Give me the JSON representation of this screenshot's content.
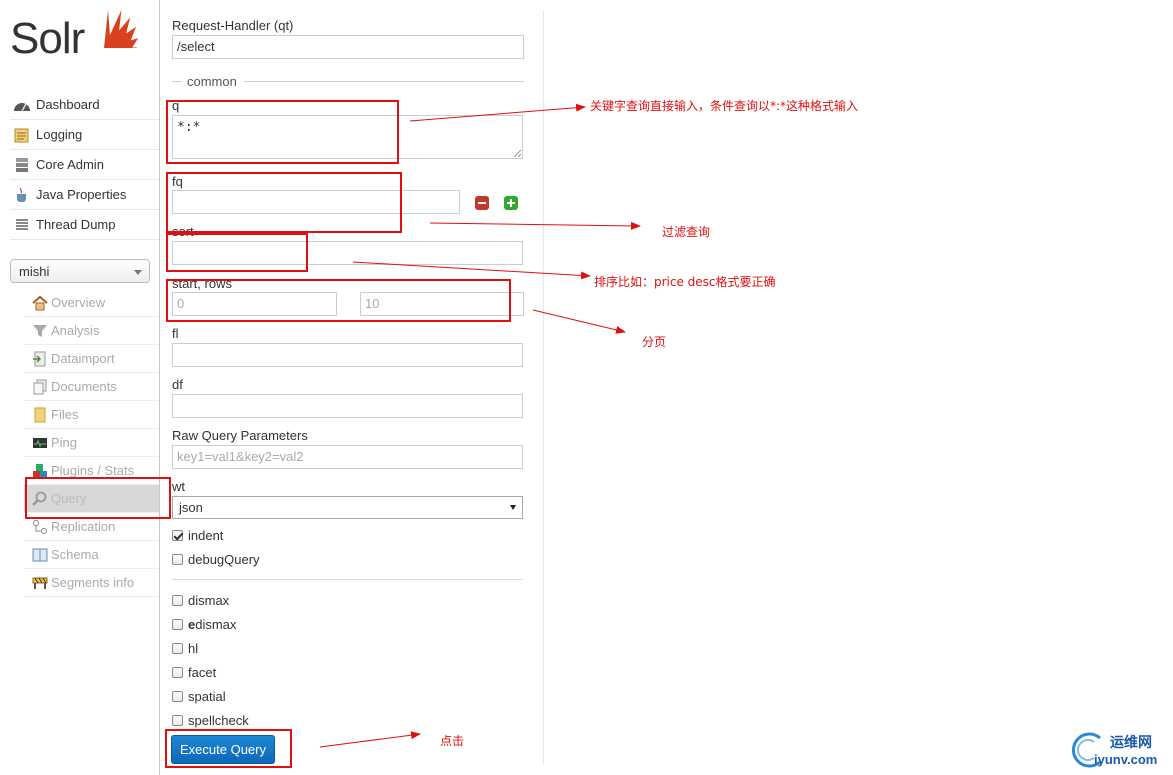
{
  "app": {
    "logo_text": "Solr"
  },
  "colors": {
    "brand_orange": "#d9411e",
    "annotation_red": "#e01010",
    "primary_blue": "#1475c8",
    "watermark_blue": "#1a5aa8"
  },
  "sidebar": {
    "main_items": [
      {
        "label": "Dashboard",
        "icon": "dashboard-icon"
      },
      {
        "label": "Logging",
        "icon": "logging-icon"
      },
      {
        "label": "Core Admin",
        "icon": "core-admin-icon"
      },
      {
        "label": "Java Properties",
        "icon": "java-properties-icon"
      },
      {
        "label": "Thread Dump",
        "icon": "thread-dump-icon"
      }
    ],
    "core_selector": {
      "selected": "mishi"
    },
    "core_items": [
      {
        "label": "Overview",
        "icon": "home-icon"
      },
      {
        "label": "Analysis",
        "icon": "filter-icon"
      },
      {
        "label": "Dataimport",
        "icon": "dataimport-icon"
      },
      {
        "label": "Documents",
        "icon": "documents-icon"
      },
      {
        "label": "Files",
        "icon": "files-icon"
      },
      {
        "label": "Ping",
        "icon": "ping-icon"
      },
      {
        "label": "Plugins / Stats",
        "icon": "plugins-icon"
      },
      {
        "label": "Query",
        "icon": "search-icon",
        "active": true
      },
      {
        "label": "Replication",
        "icon": "replication-icon"
      },
      {
        "label": "Schema",
        "icon": "schema-icon"
      },
      {
        "label": "Segments info",
        "icon": "segments-icon"
      }
    ]
  },
  "form": {
    "request_handler": {
      "label": "Request-Handler (qt)",
      "value": "/select"
    },
    "common_legend": "common",
    "q": {
      "label": "q",
      "value": "*:*"
    },
    "fq": {
      "label": "fq",
      "value": ""
    },
    "sort": {
      "label": "sort",
      "value": ""
    },
    "start_rows": {
      "label": "start, rows",
      "start_placeholder": "0",
      "rows_placeholder": "10"
    },
    "fl": {
      "label": "fl",
      "value": ""
    },
    "df": {
      "label": "df",
      "value": ""
    },
    "raw": {
      "label": "Raw Query Parameters",
      "placeholder": "key1=val1&key2=val2"
    },
    "wt": {
      "label": "wt",
      "selected": "json"
    },
    "indent": {
      "label": "indent",
      "checked": true
    },
    "debugQuery": {
      "label": "debugQuery",
      "checked": false
    },
    "options": [
      {
        "label": "dismax",
        "checked": false
      },
      {
        "label_bold": "e",
        "label_rest": "dismax",
        "checked": false
      },
      {
        "label": "hl",
        "checked": false
      },
      {
        "label": "facet",
        "checked": false
      },
      {
        "label": "spatial",
        "checked": false
      },
      {
        "label": "spellcheck",
        "checked": false
      }
    ],
    "execute_label": "Execute Query"
  },
  "annotations": {
    "q_note": "关键字查询直接输入，条件查询以*:*这种格式输入",
    "fq_note": "过滤查询",
    "sort_note": "排序比如：price  desc格式要正确",
    "paging_note": "分页",
    "click_note": "点击"
  },
  "watermark": {
    "cn": "运维网",
    "en": "iyunv.com"
  }
}
